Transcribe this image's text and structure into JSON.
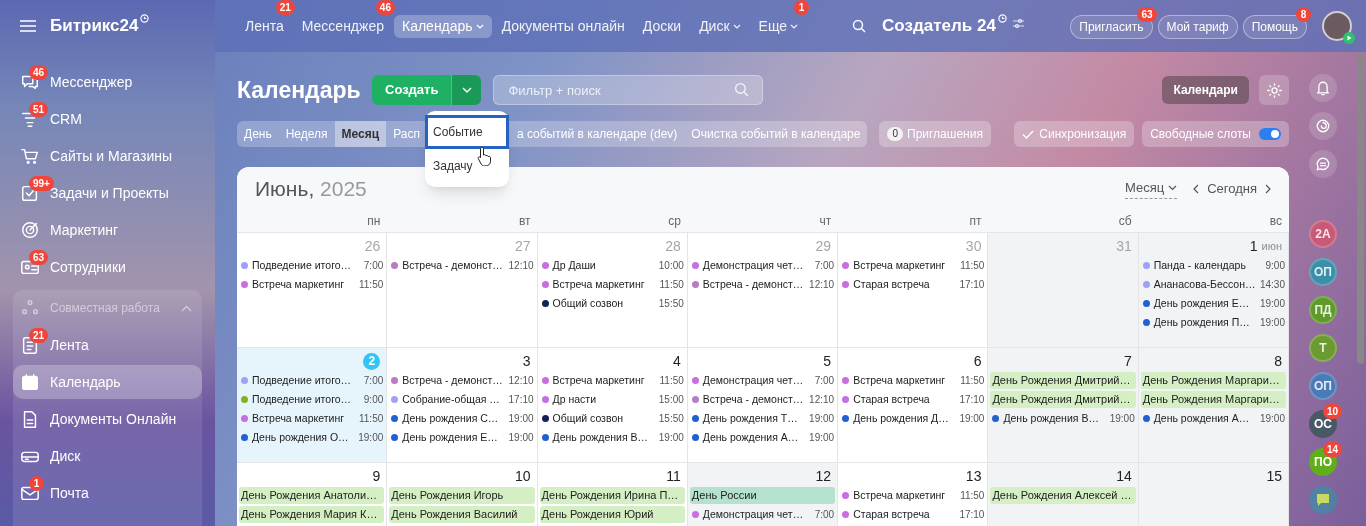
{
  "logo": {
    "text": "Битрикс24"
  },
  "top_nav": [
    {
      "label": "Лента",
      "badge": "21",
      "selected": false,
      "caret": false
    },
    {
      "label": "Мессенджер",
      "badge": "46",
      "selected": false,
      "caret": false
    },
    {
      "label": "Календарь",
      "selected": true,
      "caret": true
    },
    {
      "label": "Документы онлайн",
      "selected": false,
      "caret": false
    },
    {
      "label": "Доски",
      "selected": false,
      "caret": false
    },
    {
      "label": "Диск",
      "selected": false,
      "caret": true
    },
    {
      "label": "Еще",
      "badge": "1",
      "selected": false,
      "caret": true
    }
  ],
  "portal_name": "Создатель 24",
  "top_buttons": [
    {
      "label": "Пригласить",
      "badge": "63"
    },
    {
      "label": "Мой тариф"
    },
    {
      "label": "Помощь",
      "badge": "8"
    }
  ],
  "sidebar": {
    "items": [
      {
        "label": "Мессенджер",
        "badge": "46"
      },
      {
        "label": "CRM",
        "badge": "51"
      },
      {
        "label": "Сайты и Магазины"
      },
      {
        "label": "Задачи и Проекты",
        "badge": "99+"
      },
      {
        "label": "Маркетинг"
      },
      {
        "label": "Сотрудники",
        "badge": "63"
      }
    ],
    "group": {
      "label": "Совместная работа",
      "expanded": true,
      "children": [
        {
          "label": "Лента",
          "badge": "21",
          "selected": false
        },
        {
          "label": "Календарь",
          "selected": true
        },
        {
          "label": "Документы Онлайн",
          "selected": false
        },
        {
          "label": "Диск",
          "selected": false
        },
        {
          "label": "Почта",
          "badge": "1",
          "selected": false
        }
      ]
    }
  },
  "page_title": "Календарь",
  "create_button": "Создать",
  "search": {
    "placeholder": "Фильтр + поиск"
  },
  "calendars_button": "Календари",
  "view_tabs": [
    {
      "label": "День",
      "selected": false
    },
    {
      "label": "Неделя",
      "selected": false
    },
    {
      "label": "Месяц",
      "selected": true
    },
    {
      "label": "Расп",
      "selected": false
    },
    {
      "label": "а событий в календаре (dev)",
      "selected": false
    },
    {
      "label": "Очистка событий в календаре",
      "selected": false
    }
  ],
  "invitations": {
    "count": "0",
    "label": "Приглашения"
  },
  "sync_button": "Синхронизация",
  "free_slots": {
    "label": "Свободные слоты",
    "on": true
  },
  "create_menu": [
    {
      "label": "Событие",
      "selected": true
    },
    {
      "label": "Задачу",
      "selected": false
    }
  ],
  "calendar": {
    "month": "Июнь,",
    "year": "2025",
    "view_select": "Месяц",
    "today_button": "Сегодня",
    "weekdays": [
      "пн",
      "вт",
      "ср",
      "чт",
      "пт",
      "сб",
      "вс"
    ],
    "weeks": [
      {
        "days": [
          {
            "date": "26",
            "other_month": true,
            "dayoff": false,
            "today": false,
            "events": [
              {
                "kind": "timed",
                "title": "Подведение итого…",
                "time": "7:00",
                "color": "#9ea1f7"
              },
              {
                "kind": "timed",
                "title": "Встреча маркетинг",
                "time": "11:50",
                "color": "#c96ee0"
              }
            ]
          },
          {
            "date": "27",
            "other_month": true,
            "dayoff": false,
            "today": false,
            "events": [
              {
                "kind": "timed",
                "title": "Встреча - демонст…",
                "time": "12:10",
                "color": "#b77cc4"
              }
            ]
          },
          {
            "date": "28",
            "other_month": true,
            "dayoff": false,
            "today": false,
            "events": [
              {
                "kind": "timed",
                "title": "Др Даши",
                "time": "10:00",
                "color": "#c96ee0"
              },
              {
                "kind": "timed",
                "title": "Встреча маркетинг",
                "time": "11:50",
                "color": "#c96ee0"
              },
              {
                "kind": "timed",
                "title": "Общий созвон",
                "time": "15:50",
                "color": "#0f2455"
              }
            ]
          },
          {
            "date": "29",
            "other_month": true,
            "dayoff": false,
            "today": false,
            "events": [
              {
                "kind": "timed",
                "title": "Демонстрация чет…",
                "time": "7:00",
                "color": "#c96ee0"
              },
              {
                "kind": "timed",
                "title": "Встреча - демонст…",
                "time": "12:10",
                "color": "#b77cc4"
              }
            ]
          },
          {
            "date": "30",
            "other_month": true,
            "dayoff": false,
            "today": false,
            "events": [
              {
                "kind": "timed",
                "title": "Встреча маркетинг",
                "time": "11:50",
                "color": "#c96ee0"
              },
              {
                "kind": "timed",
                "title": "Старая встреча",
                "time": "17:10",
                "color": "#c96ee0"
              }
            ]
          },
          {
            "date": "31",
            "other_month": true,
            "dayoff": true,
            "today": false
          },
          {
            "date": "1",
            "month_label": "июн",
            "other_month": false,
            "dayoff": true,
            "today": false,
            "events": [
              {
                "kind": "timed",
                "title": "Панда - календарь",
                "time": "9:00",
                "color": "#9ea1f7"
              },
              {
                "kind": "timed",
                "title": "Ананасова-Бессон…",
                "time": "14:30",
                "color": "#9ea1f7"
              },
              {
                "kind": "timed",
                "title": "День рождения Е…",
                "time": "19:00",
                "color": "#2160d1"
              },
              {
                "kind": "timed",
                "title": "День рождения П…",
                "time": "19:00",
                "color": "#2160d1"
              }
            ]
          }
        ]
      },
      {
        "days": [
          {
            "date": "2",
            "other_month": false,
            "dayoff": false,
            "today": true,
            "events": [
              {
                "kind": "timed",
                "title": "Подведение итого…",
                "time": "7:00",
                "color": "#9ea1f7"
              },
              {
                "kind": "timed",
                "title": "Подведение итого…",
                "time": "9:00",
                "color": "#7db51b"
              },
              {
                "kind": "timed",
                "title": "Встреча маркетинг",
                "time": "11:50",
                "color": "#c96ee0"
              },
              {
                "kind": "timed",
                "title": "День рождения О…",
                "time": "19:00",
                "color": "#2160d1"
              }
            ]
          },
          {
            "date": "3",
            "other_month": false,
            "dayoff": false,
            "today": false,
            "events": [
              {
                "kind": "timed",
                "title": "Встреча - демонст…",
                "time": "12:10",
                "color": "#b77cc4"
              },
              {
                "kind": "timed",
                "title": "Собрание-общая …",
                "time": "17:10",
                "color": "#9ea1f7"
              },
              {
                "kind": "timed",
                "title": "День рождения С…",
                "time": "19:00",
                "color": "#2160d1"
              },
              {
                "kind": "timed",
                "title": "День рождения Е…",
                "time": "19:00",
                "color": "#2160d1"
              }
            ]
          },
          {
            "date": "4",
            "other_month": false,
            "dayoff": false,
            "today": false,
            "events": [
              {
                "kind": "timed",
                "title": "Встреча маркетинг",
                "time": "11:50",
                "color": "#c96ee0"
              },
              {
                "kind": "timed",
                "title": "Др насти",
                "time": "15:00",
                "color": "#c96ee0"
              },
              {
                "kind": "timed",
                "title": "Общий созвон",
                "time": "15:50",
                "color": "#0f2455"
              },
              {
                "kind": "timed",
                "title": "День рождения В…",
                "time": "19:00",
                "color": "#2160d1"
              }
            ]
          },
          {
            "date": "5",
            "other_month": false,
            "dayoff": false,
            "today": false,
            "events": [
              {
                "kind": "timed",
                "title": "Демонстрация чет…",
                "time": "7:00",
                "color": "#c96ee0"
              },
              {
                "kind": "timed",
                "title": "Встреча - демонст…",
                "time": "12:10",
                "color": "#b77cc4"
              },
              {
                "kind": "timed",
                "title": "День рождения Т…",
                "time": "19:00",
                "color": "#2160d1"
              },
              {
                "kind": "timed",
                "title": "День рождения А…",
                "time": "19:00",
                "color": "#2160d1"
              }
            ]
          },
          {
            "date": "6",
            "other_month": false,
            "dayoff": false,
            "today": false,
            "events": [
              {
                "kind": "timed",
                "title": "Встреча маркетинг",
                "time": "11:50",
                "color": "#c96ee0"
              },
              {
                "kind": "timed",
                "title": "Старая встреча",
                "time": "17:10",
                "color": "#c96ee0"
              },
              {
                "kind": "timed",
                "title": "День рождения Д…",
                "time": "19:00",
                "color": "#2160d1"
              }
            ]
          },
          {
            "date": "7",
            "other_month": false,
            "dayoff": true,
            "today": false,
            "events": [
              {
                "kind": "allday",
                "title": "День Рождения Дмитрий…",
                "color": "#d5efc4"
              },
              {
                "kind": "allday",
                "title": "День Рождения Дмитрий…",
                "color": "#d5efc4"
              },
              {
                "kind": "timed",
                "title": "День рождения В…",
                "time": "19:00",
                "color": "#2160d1"
              }
            ]
          },
          {
            "date": "8",
            "other_month": false,
            "dayoff": true,
            "today": false,
            "events": [
              {
                "kind": "allday",
                "title": "День Рождения Маргари…",
                "color": "#d5efc4"
              },
              {
                "kind": "allday",
                "title": "День Рождения Маргари…",
                "color": "#d5efc4"
              },
              {
                "kind": "timed",
                "title": "День рождения А…",
                "time": "19:00",
                "color": "#2160d1"
              }
            ]
          }
        ]
      },
      {
        "days": [
          {
            "date": "9",
            "other_month": false,
            "dayoff": false,
            "today": false,
            "events": [
              {
                "kind": "allday",
                "title": "День Рождения Анатоли…",
                "color": "#d5efc4"
              },
              {
                "kind": "allday",
                "title": "День Рождения Мария К…",
                "color": "#d5efc4"
              }
            ]
          },
          {
            "date": "10",
            "other_month": false,
            "dayoff": false,
            "today": false,
            "events": [
              {
                "kind": "allday",
                "title": "День Рождения Игорь",
                "color": "#d5efc4"
              },
              {
                "kind": "allday",
                "title": "День Рождения Василий",
                "color": "#d5efc4"
              }
            ]
          },
          {
            "date": "11",
            "other_month": false,
            "dayoff": false,
            "today": false,
            "events": [
              {
                "kind": "allday",
                "title": "День Рождения Ирина П…",
                "color": "#d5efc4"
              },
              {
                "kind": "allday",
                "title": "День Рождения Юрий",
                "color": "#d5efc4"
              }
            ]
          },
          {
            "date": "12",
            "other_month": false,
            "dayoff": true,
            "today": false,
            "events": [
              {
                "kind": "allday",
                "title": "День России",
                "color": "#b5e2ce"
              },
              {
                "kind": "timed",
                "title": "Демонстрация чет…",
                "time": "7:00",
                "color": "#c96ee0"
              }
            ]
          },
          {
            "date": "13",
            "other_month": false,
            "dayoff": false,
            "today": false,
            "events": [
              {
                "kind": "timed",
                "title": "Встреча маркетинг",
                "time": "11:50",
                "color": "#c96ee0"
              },
              {
                "kind": "timed",
                "title": "Старая встреча",
                "time": "17:10",
                "color": "#c96ee0"
              }
            ]
          },
          {
            "date": "14",
            "other_month": false,
            "dayoff": true,
            "today": false,
            "events": [
              {
                "kind": "allday",
                "title": "День Рождения Алексей …",
                "color": "#d5efc4"
              }
            ]
          },
          {
            "date": "15",
            "other_month": false,
            "dayoff": true,
            "today": false
          }
        ]
      }
    ]
  },
  "right_panel": {
    "avatars": [
      {
        "initials": "2А",
        "color": "#c85a78",
        "dimmed": true
      },
      {
        "initials": "ОП",
        "color": "#3c8fa8",
        "dimmed": true
      },
      {
        "initials": "ПД",
        "color": "#5f9a2a",
        "dimmed": true
      },
      {
        "initials": "Т",
        "color": "#6a9a30",
        "dimmed": true
      },
      {
        "initials": "ОП",
        "color": "#4a7bb8",
        "dimmed": true
      },
      {
        "initials": "ОС",
        "color": "#4a5866",
        "dimmed": false,
        "badge": "10"
      },
      {
        "initials": "ПО",
        "color": "#5fae1a",
        "dimmed": false,
        "badge": "14"
      }
    ]
  }
}
